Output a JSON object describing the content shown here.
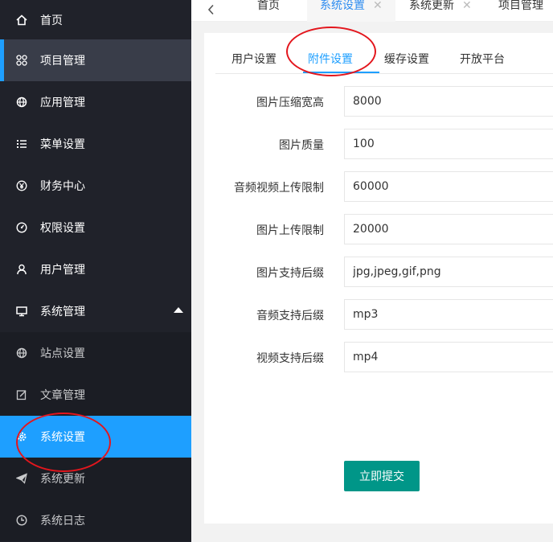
{
  "sidebar": {
    "items": [
      {
        "label": "首页",
        "icon": "home-icon"
      },
      {
        "label": "项目管理",
        "icon": "apps-icon"
      },
      {
        "label": "应用管理",
        "icon": "globe-icon"
      },
      {
        "label": "菜单设置",
        "icon": "list-icon"
      },
      {
        "label": "财务中心",
        "icon": "yen-icon"
      },
      {
        "label": "权限设置",
        "icon": "dashboard-icon"
      },
      {
        "label": "用户管理",
        "icon": "user-icon"
      },
      {
        "label": "系统管理",
        "icon": "monitor-icon"
      },
      {
        "label": "站点设置",
        "icon": "globe-icon"
      },
      {
        "label": "文章管理",
        "icon": "edit-icon"
      },
      {
        "label": "系统设置",
        "icon": "gear-icon"
      },
      {
        "label": "系统更新",
        "icon": "send-icon"
      },
      {
        "label": "系统日志",
        "icon": "clock-icon"
      }
    ]
  },
  "top_tabs": [
    {
      "label": "首页"
    },
    {
      "label": "系统设置",
      "close": "✕"
    },
    {
      "label": "系统更新",
      "close": "✕"
    },
    {
      "label": "项目管理"
    }
  ],
  "sub_tabs": [
    {
      "label": "用户设置"
    },
    {
      "label": "附件设置"
    },
    {
      "label": "缓存设置"
    },
    {
      "label": "开放平台"
    }
  ],
  "form": {
    "fields": [
      {
        "label": "图片压缩宽高",
        "value": "8000"
      },
      {
        "label": "图片质量",
        "value": "100"
      },
      {
        "label": "音频视频上传限制",
        "value": "60000"
      },
      {
        "label": "图片上传限制",
        "value": "20000"
      },
      {
        "label": "图片支持后缀",
        "value": "jpg,jpeg,gif,png"
      },
      {
        "label": "音频支持后缀",
        "value": "mp3"
      },
      {
        "label": "视频支持后缀",
        "value": "mp4"
      }
    ],
    "submit_label": "立即提交"
  },
  "colors": {
    "sidebar_bg": "#20222a",
    "accent": "#1e9fff",
    "submit": "#009688",
    "annotation": "#e3161d"
  }
}
